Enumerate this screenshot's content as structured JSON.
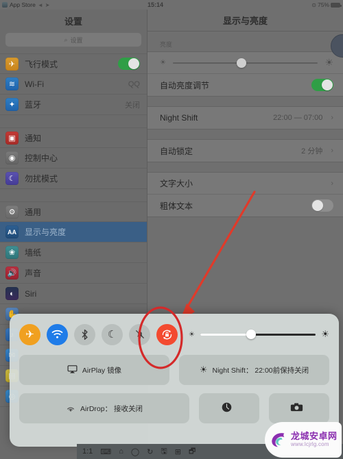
{
  "statusbar": {
    "app_icon": "appstore-icon",
    "app_name": "App Store",
    "back_arrow": "◄",
    "share_arrow": "➤",
    "time": "15:14",
    "battery_percent": "75%",
    "lock_icon": "🔒"
  },
  "sidebar": {
    "title": "设置",
    "search_placeholder": "设置",
    "search_icon": "search-icon",
    "groups": [
      {
        "items": [
          {
            "icon": "airplane",
            "label": "飞行模式",
            "control": "toggle",
            "on": true
          },
          {
            "icon": "wifi",
            "label": "Wi-Fi",
            "value": "QQ",
            "control": "value"
          },
          {
            "icon": "bt",
            "label": "蓝牙",
            "value": "关闭",
            "control": "value"
          }
        ]
      },
      {
        "items": [
          {
            "icon": "notif",
            "label": "通知",
            "control": "none"
          },
          {
            "icon": "cc",
            "label": "控制中心",
            "control": "none"
          },
          {
            "icon": "dnd",
            "label": "勿扰模式",
            "control": "none"
          }
        ]
      },
      {
        "items": [
          {
            "icon": "general",
            "label": "通用",
            "control": "none"
          },
          {
            "icon": "display",
            "label": "显示与亮度",
            "control": "none",
            "selected": true
          },
          {
            "icon": "wallpaper",
            "label": "墙纸",
            "control": "none"
          },
          {
            "icon": "sound",
            "label": "声音",
            "control": "none"
          },
          {
            "icon": "siri",
            "label": "Siri",
            "control": "none"
          },
          {
            "icon": "privacy",
            "label": "",
            "control": "none"
          },
          {
            "icon": "itunes",
            "label": "",
            "control": "none"
          },
          {
            "icon": "mail",
            "label": "",
            "control": "none"
          },
          {
            "icon": "notes",
            "label": "",
            "control": "none"
          },
          {
            "icon": "safari",
            "label": "",
            "control": "none"
          },
          {
            "icon": "darkgrey",
            "label": "",
            "control": "none"
          }
        ]
      }
    ]
  },
  "detail": {
    "title": "显示与亮度",
    "brightness_section_label": "亮度",
    "brightness_value_percent": 44,
    "brightness_low_icon": "sun-small-icon",
    "brightness_high_icon": "sun-large-icon",
    "rows": [
      {
        "label": "自动亮度调节",
        "control": "toggle",
        "on": true
      },
      {
        "label": "Night Shift",
        "value": "22:00 — 07:00",
        "control": "chevron"
      },
      {
        "label": "自动锁定",
        "value": "2 分钟",
        "control": "chevron"
      },
      {
        "label": "文字大小",
        "value": "",
        "control": "chevron"
      },
      {
        "label": "粗体文本",
        "control": "toggle",
        "on": false
      }
    ]
  },
  "control_center": {
    "toggles": [
      {
        "name": "airplane-mode",
        "icon": "✈",
        "state": "on",
        "color": "#f0a020"
      },
      {
        "name": "wifi",
        "icon": "wifi-icon",
        "state": "on",
        "color": "#1f7ce8"
      },
      {
        "name": "bluetooth",
        "icon": "bluetooth-icon",
        "state": "off",
        "color": "#b9bfbd"
      },
      {
        "name": "do-not-disturb",
        "icon": "☾",
        "state": "off",
        "color": "#b9bfbd"
      },
      {
        "name": "mute",
        "icon": "bell-slash-icon",
        "state": "off",
        "color": "#b9bfbd"
      },
      {
        "name": "rotation-lock",
        "icon": "rotation-lock-icon",
        "state": "on",
        "color": "#f34a30"
      }
    ],
    "brightness_percent": 44,
    "tiles": [
      {
        "name": "airplay-mirror",
        "icon": "airplay-icon",
        "label": "AirPlay 镜像"
      },
      {
        "name": "night-shift",
        "icon": "night-shift-icon",
        "label": "Night Shift： 22:00前保持关闭"
      },
      {
        "name": "airdrop",
        "icon": "airdrop-icon",
        "label": "AirDrop： 接收关闭"
      },
      {
        "name": "timer",
        "icon": "timer-icon",
        "label": ""
      },
      {
        "name": "camera",
        "icon": "camera-icon",
        "label": ""
      }
    ]
  },
  "taskbar": {
    "items": [
      "1:1",
      "⌨",
      "⌂",
      "◯",
      "↻",
      "🖫",
      "⊞",
      "🗗"
    ]
  },
  "annotation": {
    "type": "red-arrow-and-ellipse",
    "color": "#e03030",
    "target": "rotation-lock-toggle"
  },
  "watermark": {
    "site_name": "龙城安卓网",
    "url": "www.lcjrlg.com",
    "logo": "dragon-c-logo"
  }
}
